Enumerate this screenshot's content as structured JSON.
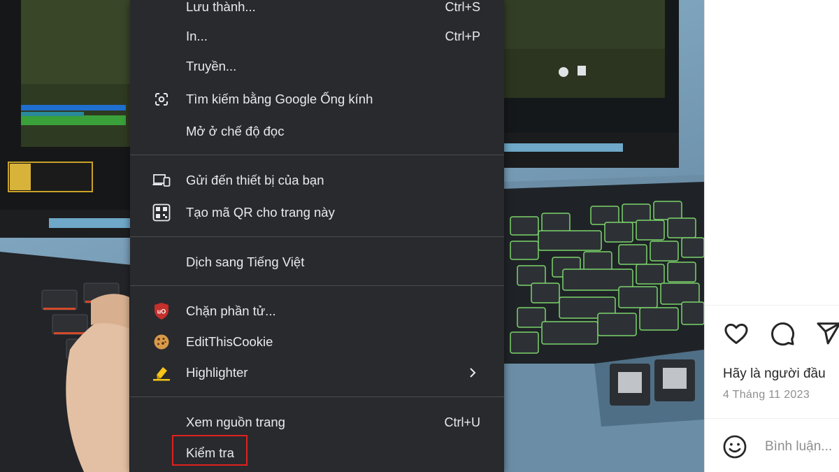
{
  "context_menu": {
    "items": [
      {
        "label": "Lưu thành...",
        "shortcut": "Ctrl+S"
      },
      {
        "label": "In...",
        "shortcut": "Ctrl+P"
      },
      {
        "label": "Truyền..."
      },
      {
        "label": "Tìm kiếm bằng Google Ống kính",
        "icon": "google-lens-icon"
      },
      {
        "label": "Mở ở chế độ đọc"
      },
      {
        "label": "Gửi đến thiết bị của bạn",
        "icon": "send-to-devices-icon"
      },
      {
        "label": "Tạo mã QR cho trang này",
        "icon": "qr-code-icon"
      },
      {
        "label": "Dịch sang Tiếng Việt"
      },
      {
        "label": "Chặn phần tử...",
        "icon": "ublock-origin-icon"
      },
      {
        "label": "EditThisCookie",
        "icon": "cookie-icon"
      },
      {
        "label": "Highlighter",
        "icon": "highlighter-icon",
        "submenu_icon": "chevron-right-icon"
      },
      {
        "label": "Xem nguồn trang",
        "shortcut": "Ctrl+U"
      },
      {
        "label": "Kiểm tra",
        "highlighted": true
      }
    ],
    "highlight_color": "#e02020"
  },
  "instagram": {
    "action_icons": [
      "heart-icon",
      "comment-icon",
      "share-icon"
    ],
    "likes_text": "Hãy là người đầu",
    "date": "4 Tháng 11 2023",
    "comment_placeholder": "Bình luận..."
  },
  "colors": {
    "menu_background": "#292a2d",
    "menu_text": "#e8eaed",
    "ublock_red": "#c4302b"
  }
}
